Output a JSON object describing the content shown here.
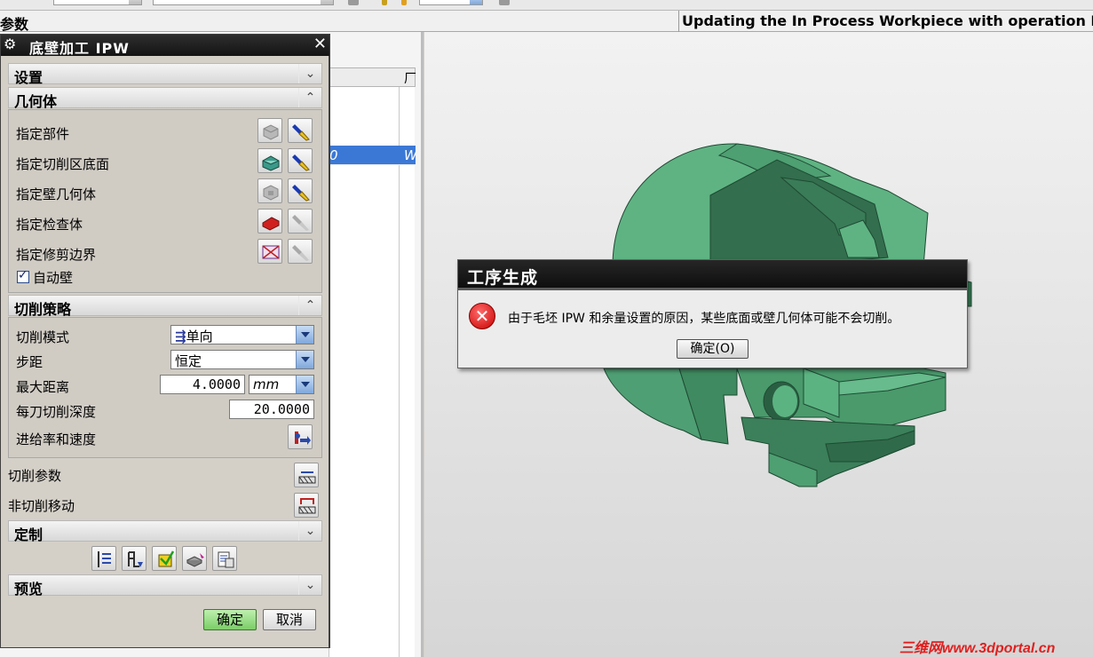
{
  "status_bar": {
    "left_label": "参数",
    "message": "Updating the In Process Workpiece with operation FLOOR"
  },
  "background_list": {
    "header_fragment": "厂",
    "selected_row": {
      "col1": "0",
      "col2": "W"
    }
  },
  "dialog": {
    "title": "底壁加工 IPW",
    "sections": {
      "settings": "设置",
      "geometry": "几何体",
      "strategy": "切削策略",
      "custom": "定制",
      "preview": "预览"
    },
    "geometry_rows": [
      {
        "label": "指定部件"
      },
      {
        "label": "指定切削区底面"
      },
      {
        "label": "指定壁几何体"
      },
      {
        "label": "指定检查体"
      },
      {
        "label": "指定修剪边界"
      }
    ],
    "auto_wall": {
      "label": "自动壁",
      "checked": true
    },
    "strategy": {
      "cut_pattern": {
        "label": "切削模式",
        "value": "单向"
      },
      "stepover": {
        "label": "步距",
        "value": "恒定"
      },
      "max_distance": {
        "label": "最大距离",
        "value": "4.0000",
        "unit": "mm"
      },
      "depth_per_cut": {
        "label": "每刀切削深度",
        "value": "20.0000"
      },
      "feeds_speeds": {
        "label": "进给率和速度"
      }
    },
    "cut_params_label": "切削参数",
    "non_cut_moves_label": "非切削移动",
    "ok_label": "确定",
    "cancel_label": "取消"
  },
  "error_popup": {
    "title": "工序生成",
    "message": "由于毛坯 IPW 和余量设置的原因，某些底面或壁几何体可能不会切削。",
    "ok_label": "确定(O)"
  },
  "watermark": "三维网www.3dportal.cn",
  "colors": {
    "part_green": "#3f9a6a",
    "selection_blue": "#3b78d6",
    "error_red": "#d01010"
  }
}
